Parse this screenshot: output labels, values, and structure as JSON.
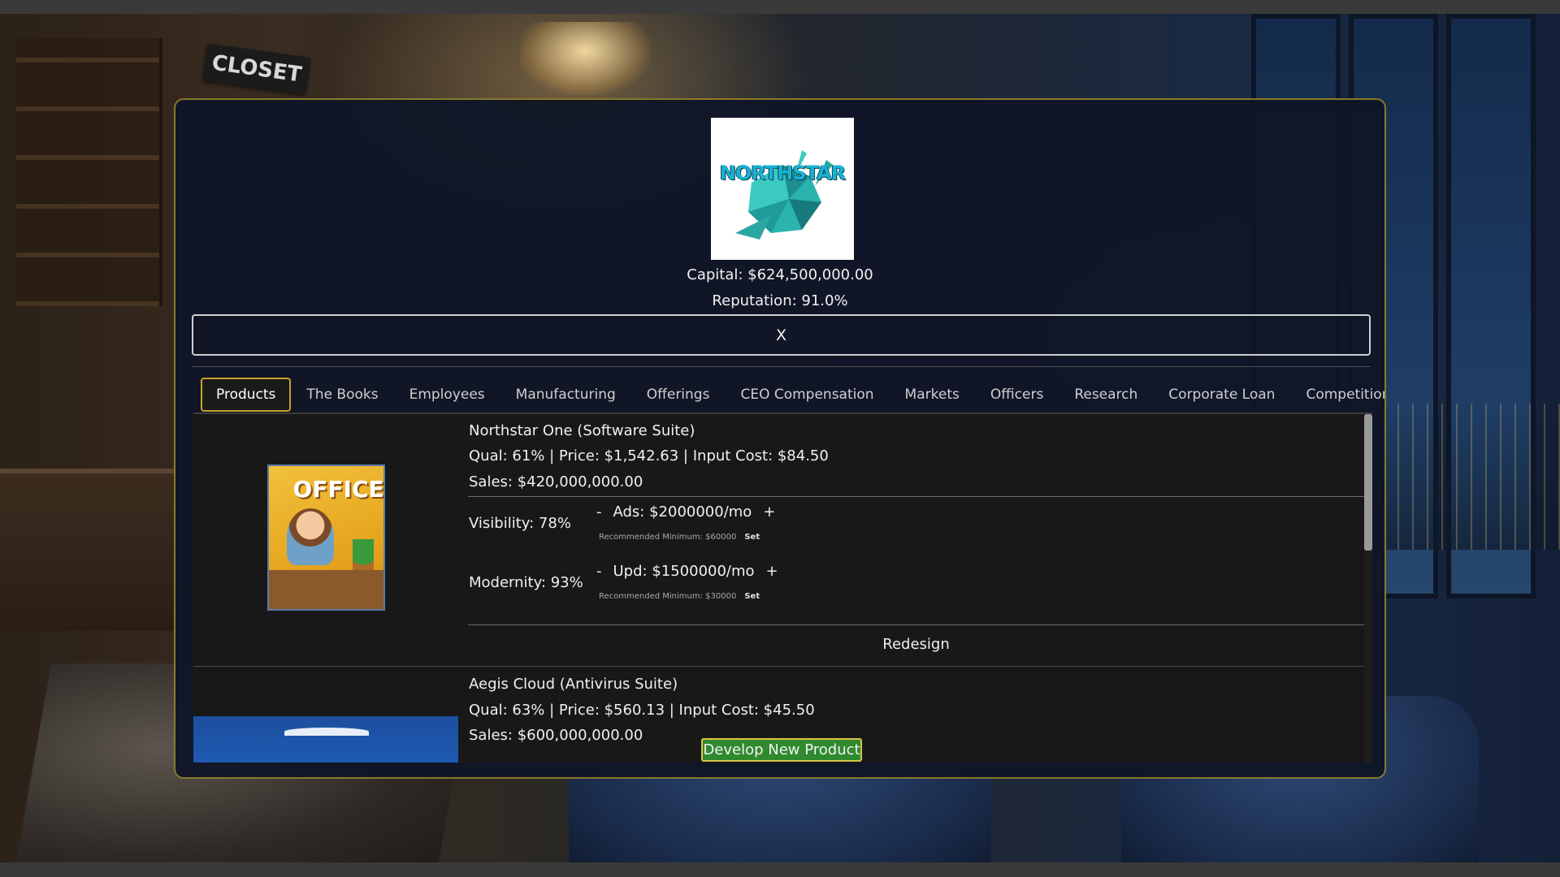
{
  "scene": {
    "closet_sign": "CLOSET"
  },
  "company": {
    "logo_text": "NORTHSTAR",
    "capital": "Capital: $624,500,000.00",
    "reputation": "Reputation: 91.0%"
  },
  "close_button": {
    "label": "X"
  },
  "tabs": [
    {
      "label": "Products",
      "active": true
    },
    {
      "label": "The Books"
    },
    {
      "label": "Employees"
    },
    {
      "label": "Manufacturing"
    },
    {
      "label": "Offerings"
    },
    {
      "label": "CEO Compensation"
    },
    {
      "label": "Markets"
    },
    {
      "label": "Officers"
    },
    {
      "label": "Research"
    },
    {
      "label": "Corporate Loan"
    },
    {
      "label": "Competition"
    }
  ],
  "products": [
    {
      "name": "Northstar One (Software Suite)",
      "stats": "Qual: 61% | Price: $1,542.63 | Input Cost: $84.50",
      "sales": "Sales: $420,000,000.00",
      "box_title": "OFFICE",
      "visibility": {
        "label": "Visibility: 78%",
        "minus": "-",
        "value": "Ads: $2000000/mo",
        "plus": "+",
        "recommended": "Recommended Minimum: $60000",
        "set": "Set"
      },
      "modernity": {
        "label": "Modernity: 93%",
        "minus": "-",
        "value": "Upd: $1500000/mo",
        "plus": "+",
        "recommended": "Recommended Minimum: $30000",
        "set": "Set"
      },
      "redesign": "Redesign"
    },
    {
      "name": "Aegis Cloud (Antivirus Suite)",
      "stats": "Qual: 63% | Price: $560.13 | Input Cost: $45.50",
      "sales": "Sales: $600,000,000.00"
    }
  ],
  "develop_button": {
    "label": "Develop New Product"
  },
  "colors": {
    "panel_border": "#8a7a2a",
    "active_tab_border": "#c9a227",
    "develop_button_bg": "#2f8a2f",
    "develop_button_border": "#d9c34a",
    "logo_text": "#17b3d6"
  },
  "icons": {
    "logo": "northstar-crystal-logo",
    "product_1": "office-box-image",
    "product_2": "cloud-box-image"
  }
}
